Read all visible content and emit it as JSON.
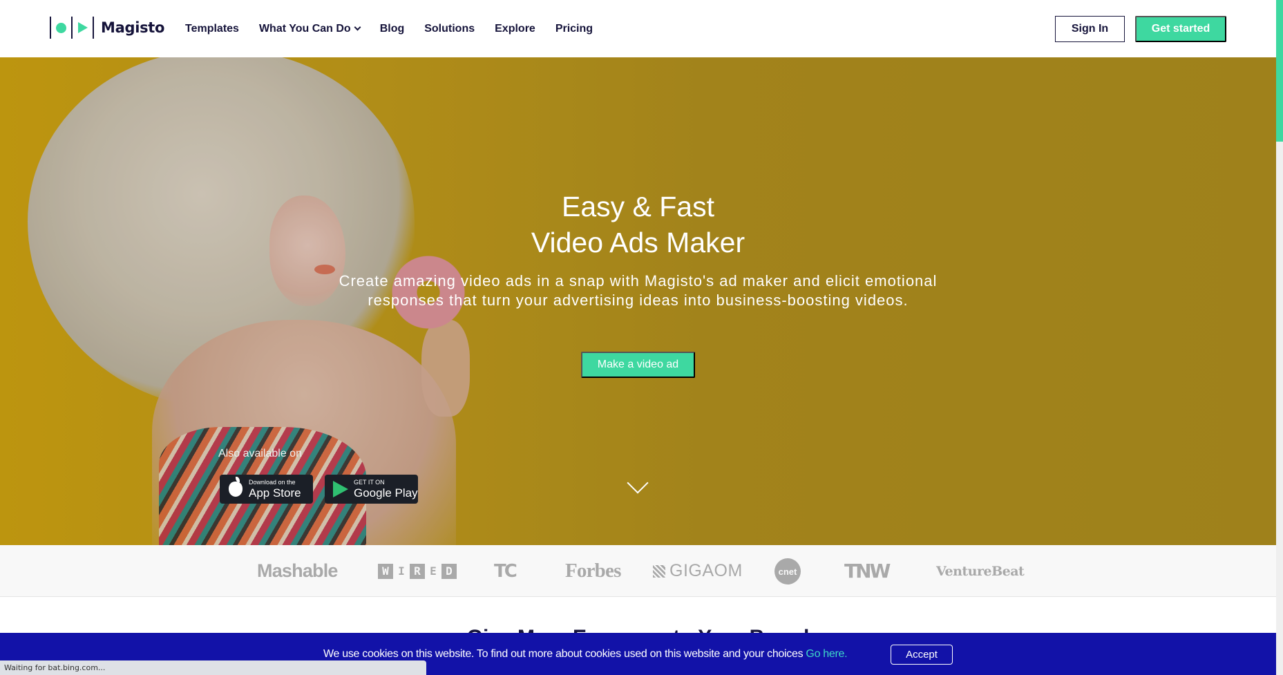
{
  "header": {
    "logo_text": "Magisto",
    "nav": [
      {
        "label": "Templates",
        "has_dropdown": false
      },
      {
        "label": "What You Can Do",
        "has_dropdown": true
      },
      {
        "label": "Blog",
        "has_dropdown": false
      },
      {
        "label": "Solutions",
        "has_dropdown": false
      },
      {
        "label": "Explore",
        "has_dropdown": false
      },
      {
        "label": "Pricing",
        "has_dropdown": false
      }
    ],
    "sign_in_label": "Sign In",
    "get_started_label": "Get started"
  },
  "hero": {
    "title_line1": "Easy & Fast",
    "title_line2": "Video Ads Maker",
    "subtitle_line1": "Create amazing video ads in a snap with Magisto's ad maker and elicit emotional",
    "subtitle_line2": "responses that turn your advertising ideas into business-boosting videos.",
    "cta_label": "Make a video ad",
    "also_available": "Also available on",
    "app_store": {
      "small": "Download on the",
      "big": "App Store"
    },
    "google_play": {
      "small": "GET IT ON",
      "big": "Google Play"
    },
    "scroll_icon": "chevron-down-icon"
  },
  "press": {
    "logos": [
      "Mashable",
      "WIRED",
      "TC",
      "Forbes",
      "GIGAOM",
      "cnet",
      "TNW",
      "VentureBeat"
    ]
  },
  "next_section": {
    "heading": "Give More Exposure to Your Brand"
  },
  "cookie": {
    "text": "We use cookies on this website. To find out more about cookies used on this website and your choices ",
    "link": "Go here.",
    "accept_label": "Accept"
  },
  "browser_status": "Waiting for bat.bing.com...",
  "colors": {
    "accent": "#3ed8a0",
    "brand_dark": "#15133a",
    "cookie_bg": "#1212a8",
    "hero_bg": "#c9a11c",
    "press_logo": "#a9a9a9"
  }
}
